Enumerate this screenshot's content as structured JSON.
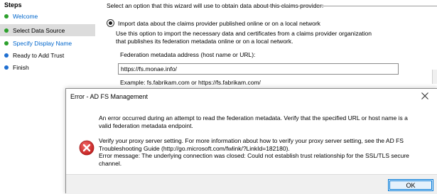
{
  "wizard": {
    "steps_title": "Steps",
    "steps": [
      {
        "label": "Welcome",
        "dot_color": "#2ca02c",
        "link": true,
        "selected": false
      },
      {
        "label": "Select Data Source",
        "dot_color": "#2ca02c",
        "link": false,
        "selected": true
      },
      {
        "label": "Specify Display Name",
        "dot_color": "#2ca02c",
        "link": true,
        "selected": false
      },
      {
        "label": "Ready to Add Trust",
        "dot_color": "#1f6fd1",
        "link": false,
        "selected": false
      },
      {
        "label": "Finish",
        "dot_color": "#1f6fd1",
        "link": false,
        "selected": false
      }
    ],
    "instruction": "Select an option that this wizard will use to obtain data about this claims provider:",
    "option_label": "Import data about the claims provider published online or on a local network",
    "option_description": "Use this option to import the necessary data and certificates from a claims provider organization that publishes its federation metadata online or on a local network.",
    "field_label": "Federation metadata address (host name or URL):",
    "field_value": "https://fs.monae.info/",
    "example": "Example: fs.fabrikam.com or https://fs.fabrikam.com/"
  },
  "dialog": {
    "title": "Error - AD FS Management",
    "message_primary": "An error occurred during an attempt to read the federation metadata.  Verify that the specified URL or host name is a valid federation metadata endpoint.",
    "message_detail": "Verify your proxy server setting. For more information about how to verify your proxy server setting, see the AD FS Troubleshooting Guide (http://go.microsoft.com/fwlink/?LinkId=182180).",
    "message_error": "Error message: The underlying connection was closed: Could not establish trust relationship for the SSL/TLS secure channel.",
    "ok_label": "OK",
    "icon": "error-icon",
    "close_icon": "close-icon"
  },
  "colors": {
    "link": "#0066cc",
    "error_red": "#d9302f",
    "accent": "#0078d7"
  }
}
